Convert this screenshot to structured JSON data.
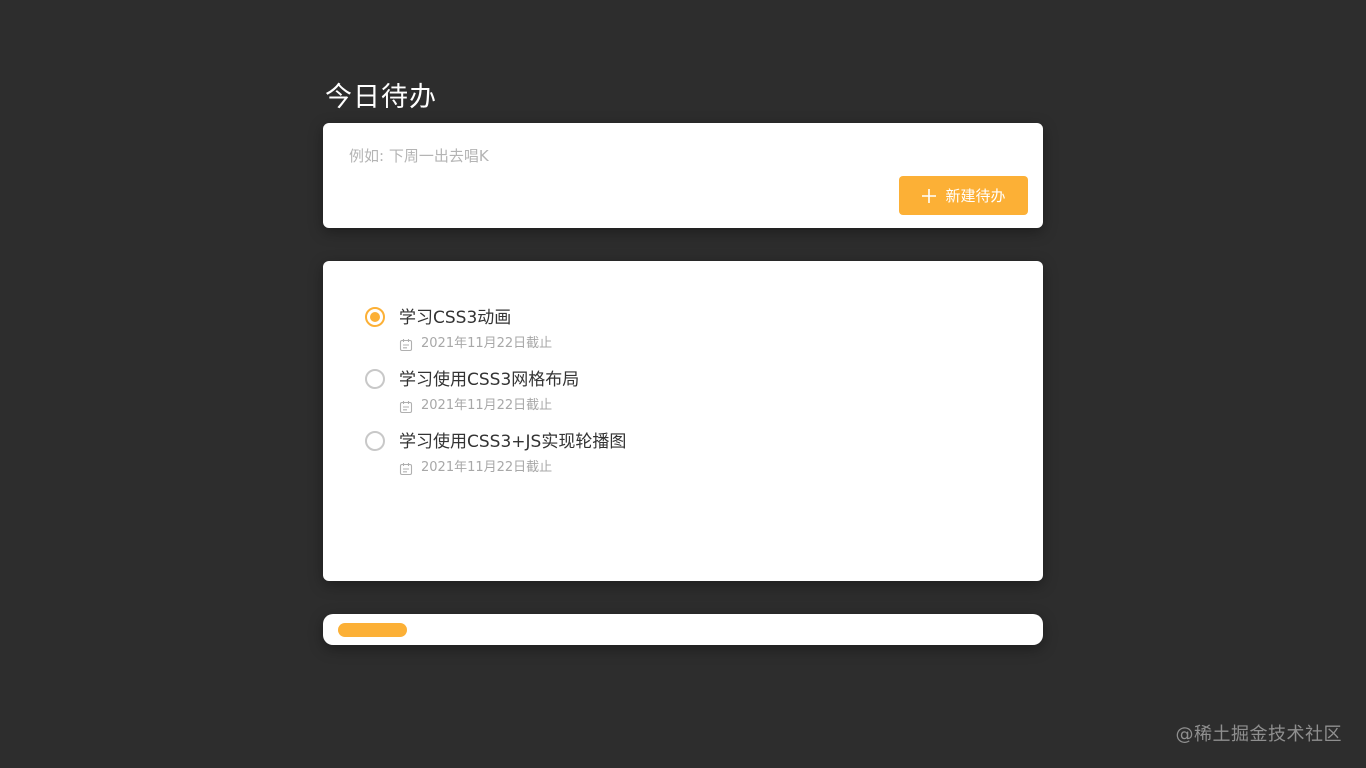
{
  "page": {
    "title": "今日待办"
  },
  "new_todo": {
    "placeholder": "例如: 下周一出去唱K",
    "value": "",
    "button_label": "新建待办",
    "button_icon": "plus-icon"
  },
  "todos": [
    {
      "title": "学习CSS3动画",
      "deadline": "2021年11月22日截止",
      "checked": true,
      "icon": "calendar-icon"
    },
    {
      "title": "学习使用CSS3网格布局",
      "deadline": "2021年11月22日截止",
      "checked": false,
      "icon": "calendar-icon"
    },
    {
      "title": "学习使用CSS3+JS实现轮播图",
      "deadline": "2021年11月22日截止",
      "checked": false,
      "icon": "calendar-icon"
    }
  ],
  "progress": {
    "completed": 1,
    "total": 3,
    "fraction": 0.1
  },
  "watermark": "@稀土掘金技术社区",
  "colors": {
    "background": "#2d2d2d",
    "accent": "#fcb036",
    "card": "#ffffff",
    "text_primary": "#333333",
    "text_muted": "#a8a8a8"
  }
}
